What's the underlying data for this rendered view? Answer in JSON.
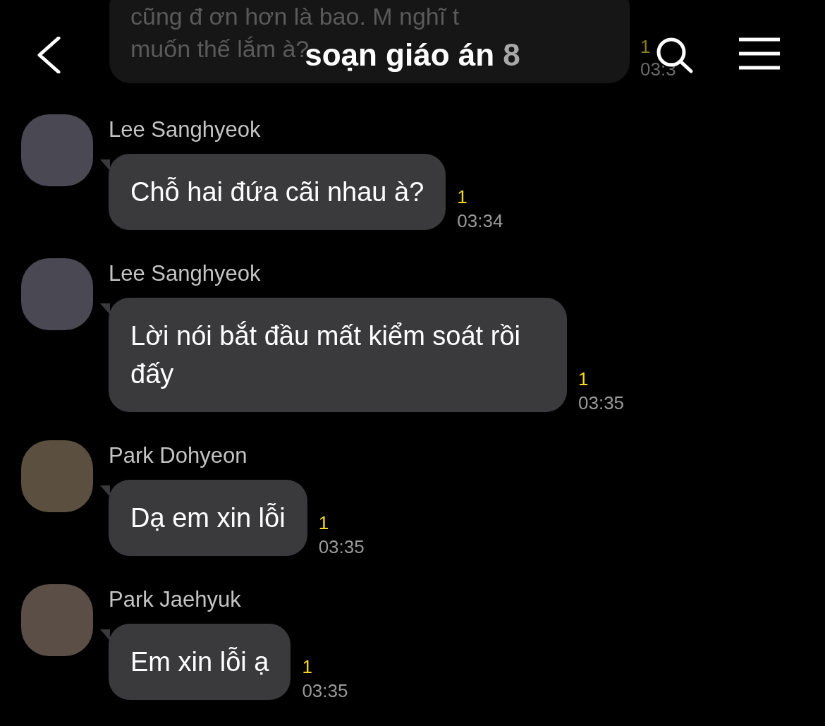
{
  "header": {
    "title": "soạn giáo án",
    "member_count": "8"
  },
  "partial_message": {
    "lines": [
      "cũng đ ơn hơn là bao. M nghĩ t",
      "muốn thế lắm à?"
    ],
    "unread": "1",
    "time": "03:3"
  },
  "messages": [
    {
      "sender": "Lee Sanghyeok",
      "text": "Chỗ hai đứa cãi nhau à?",
      "unread": "1",
      "time": "03:34"
    },
    {
      "sender": "Lee Sanghyeok",
      "text": "Lời nói bắt đầu mất kiểm soát rồi đấy",
      "unread": "1",
      "time": "03:35"
    },
    {
      "sender": "Park Dohyeon",
      "text": "Dạ em xin lỗi",
      "unread": "1",
      "time": "03:35"
    },
    {
      "sender": "Park Jaehyuk",
      "text": "Em xin lỗi ạ",
      "unread": "1",
      "time": "03:35"
    }
  ]
}
